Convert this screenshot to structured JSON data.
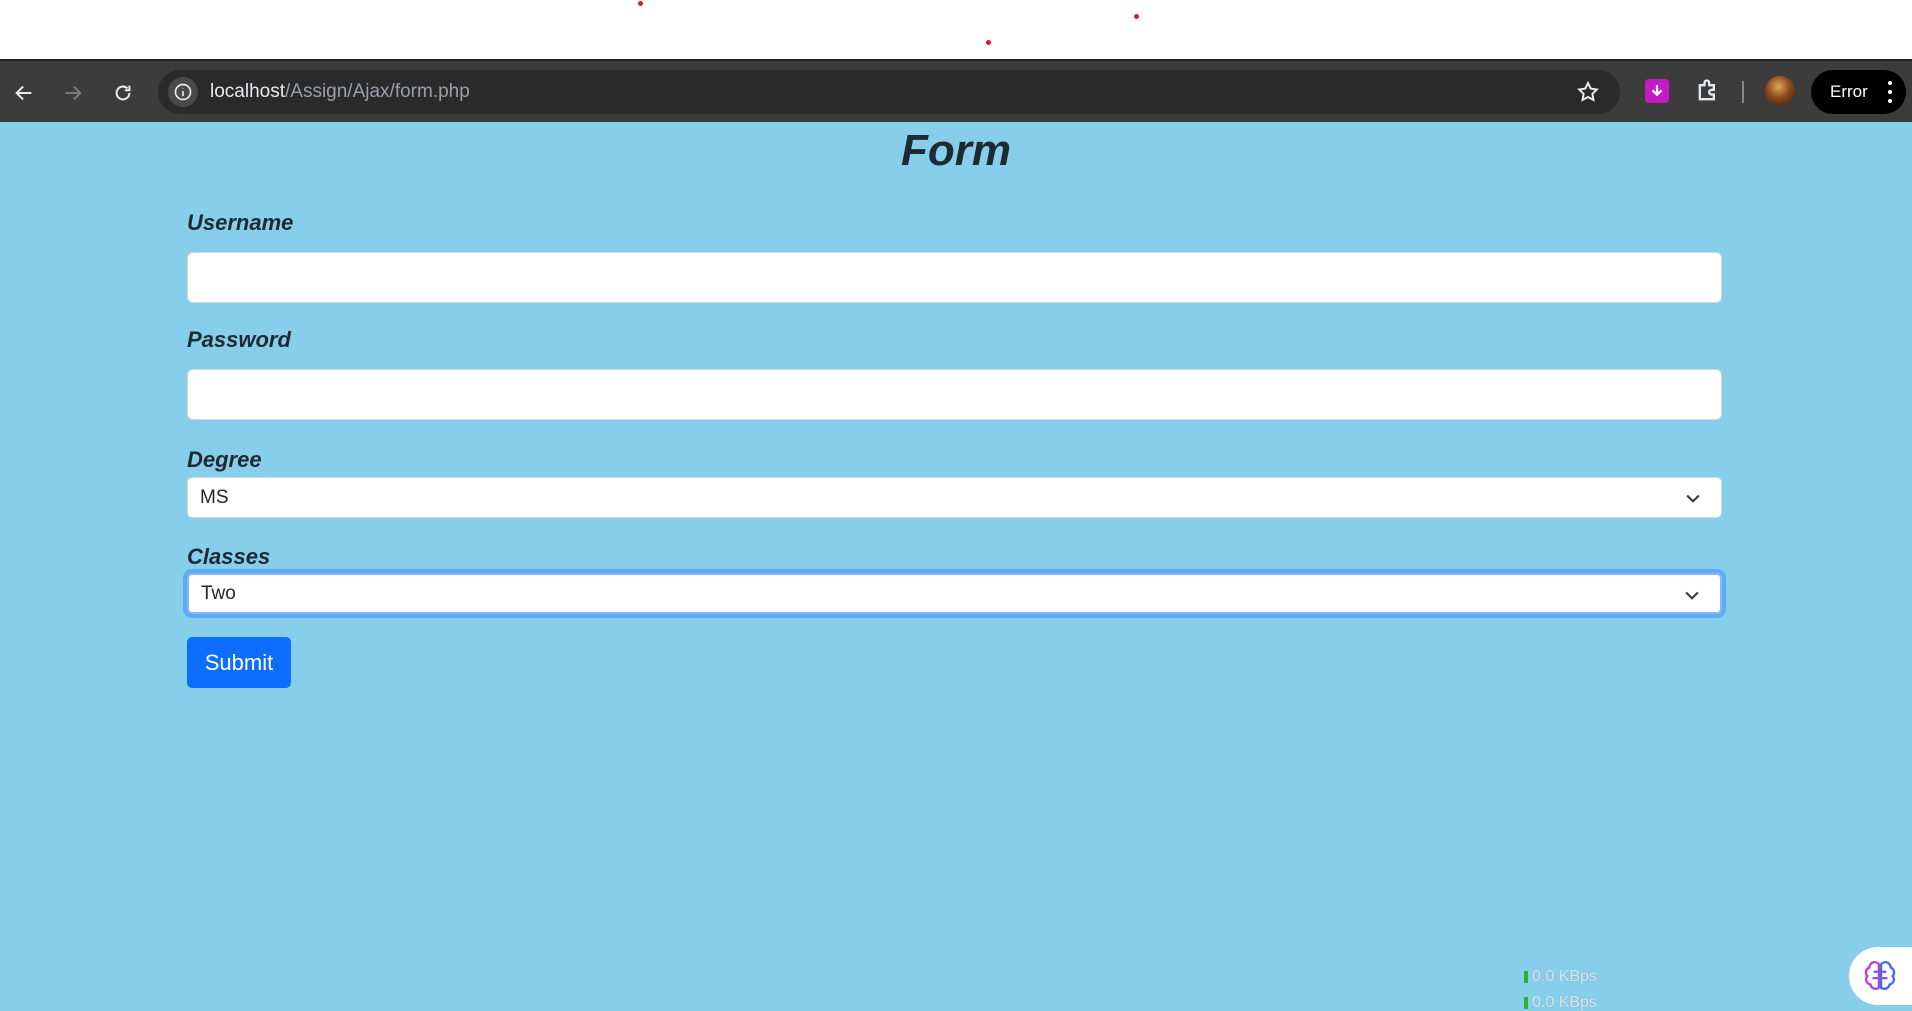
{
  "browser": {
    "url_host": "localhost",
    "url_path": "/Assign/Ajax/form.php",
    "profile_status": "Error"
  },
  "form": {
    "title": "Form",
    "username_label": "Username",
    "username_value": "",
    "password_label": "Password",
    "password_value": "",
    "degree_label": "Degree",
    "degree_value": "MS",
    "classes_label": "Classes",
    "classes_value": "Two",
    "submit_label": "Submit"
  },
  "network_meter": {
    "upload": "0.0 KBps",
    "download": "0.0 KBps"
  },
  "colors": {
    "page_background": "#87ceeb",
    "primary_button": "#0d6efd",
    "toolbar": "#3c3c3c"
  }
}
